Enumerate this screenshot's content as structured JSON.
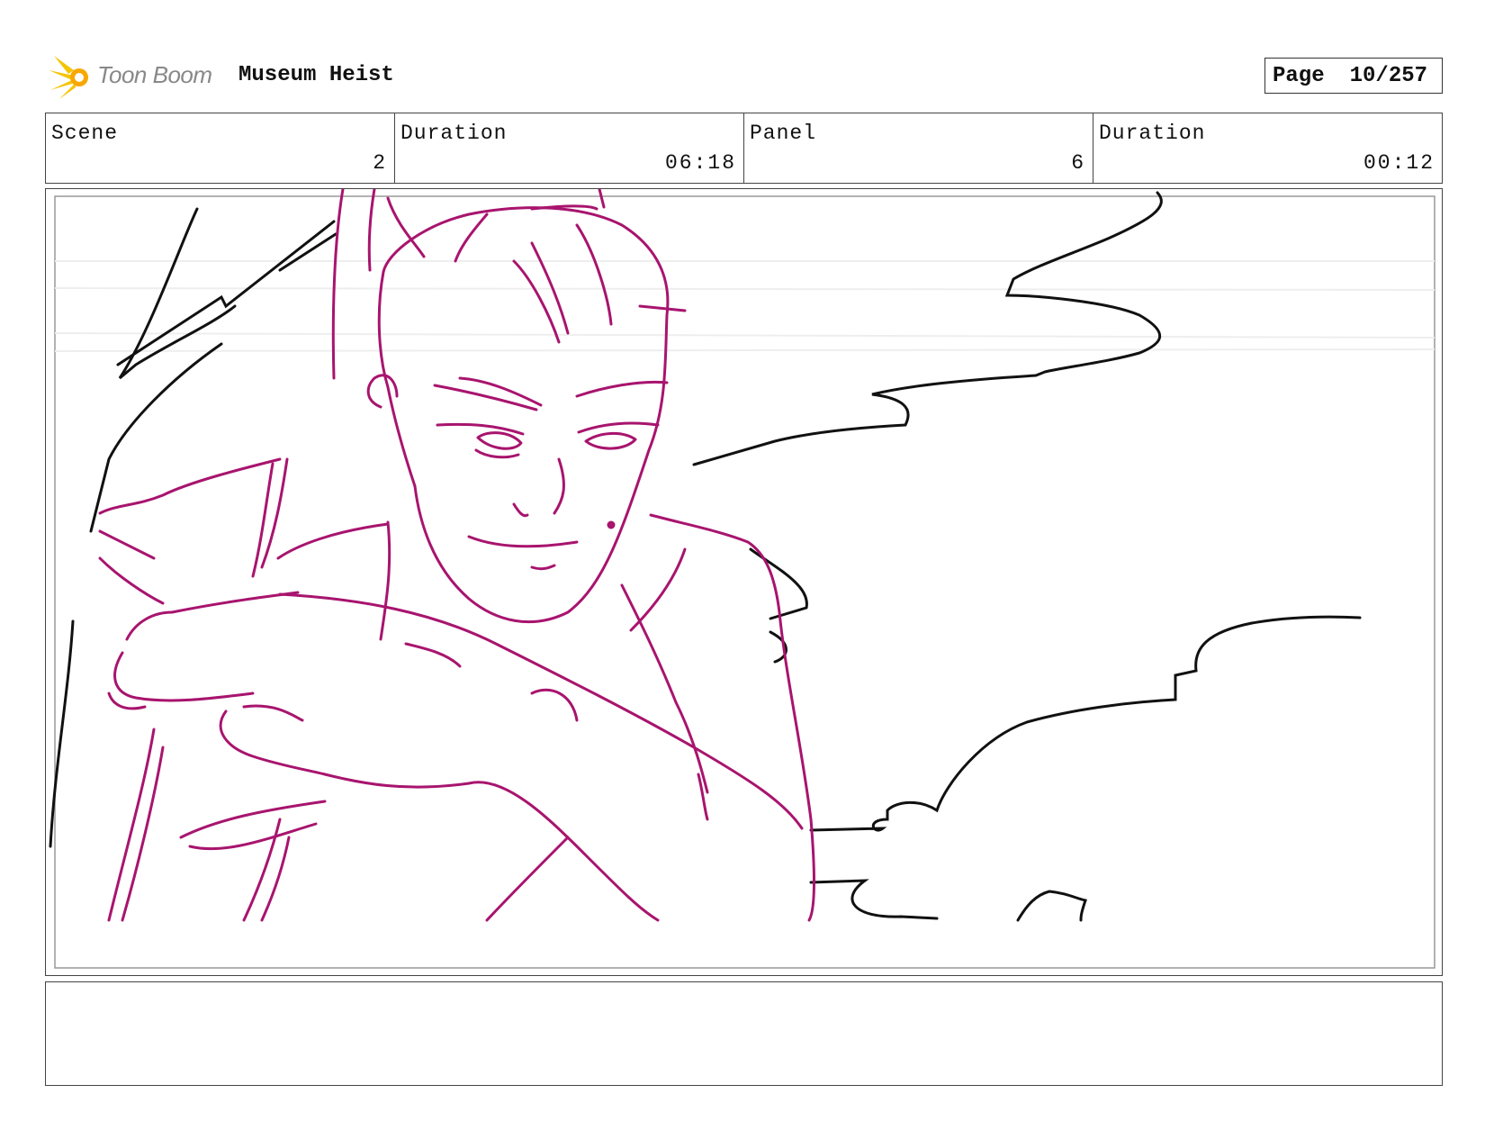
{
  "header": {
    "logo_text": "Toon Boom",
    "project_title": "Museum Heist",
    "page_label": "Page",
    "page_value": "10/257"
  },
  "info": {
    "scene_label": "Scene",
    "scene_value": "2",
    "scene_duration_label": "Duration",
    "scene_duration_value": "06:18",
    "panel_label": "Panel",
    "panel_value": "6",
    "panel_duration_label": "Duration",
    "panel_duration_value": "00:12"
  },
  "colors": {
    "sketch_magenta": "#a8146e",
    "sketch_black": "#111111",
    "logo_yellow": "#f5c400"
  },
  "notes": {
    "text": ""
  }
}
